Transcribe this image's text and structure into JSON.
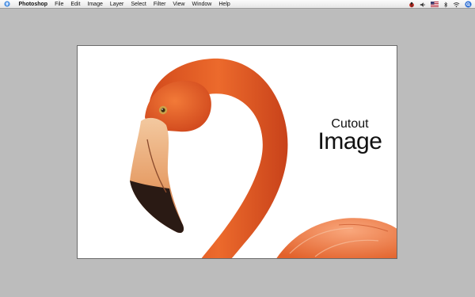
{
  "menubar": {
    "app_name": "Photoshop",
    "items": [
      "File",
      "Edit",
      "Image",
      "Layer",
      "Select",
      "Filter",
      "View",
      "Window",
      "Help"
    ],
    "status_icons": [
      "ladybug-icon",
      "volume-icon",
      "flag-icon",
      "bluetooth-icon",
      "wifi-icon",
      "spotlight-icon"
    ]
  },
  "document": {
    "caption_line1": "Cutout",
    "caption_line2": "Image"
  },
  "colors": {
    "desktop": "#bcbcbc",
    "canvas": "#ffffff",
    "flamingo": "#e8622a",
    "beak_tip": "#2a1a14"
  }
}
